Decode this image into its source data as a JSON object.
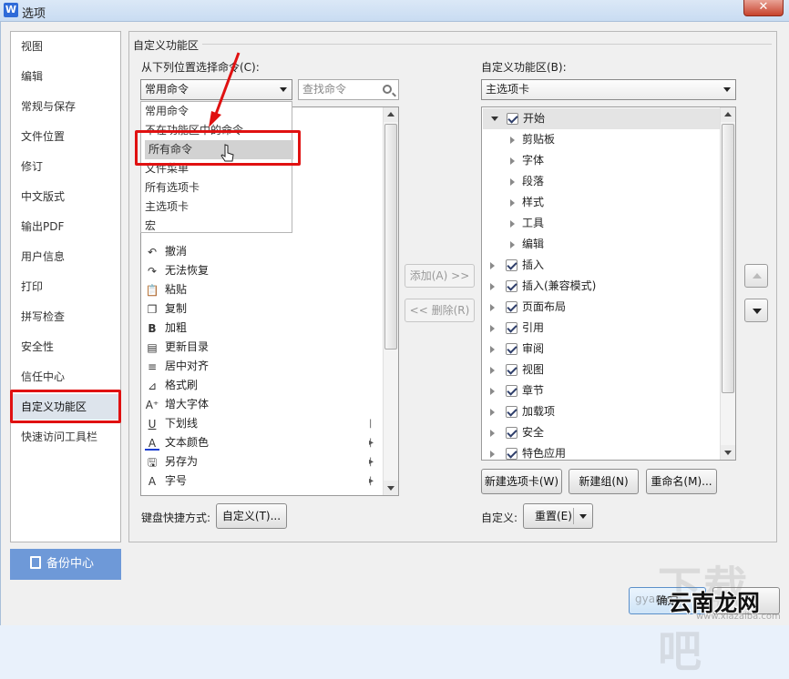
{
  "window": {
    "title": "选项",
    "app_icon_letter": "W",
    "close_glyph": "✕"
  },
  "sidebar": {
    "items": [
      {
        "label": "视图"
      },
      {
        "label": "编辑"
      },
      {
        "label": "常规与保存"
      },
      {
        "label": "文件位置"
      },
      {
        "label": "修订"
      },
      {
        "label": "中文版式"
      },
      {
        "label": "输出PDF"
      },
      {
        "label": "用户信息"
      },
      {
        "label": "打印"
      },
      {
        "label": "拼写检查"
      },
      {
        "label": "安全性"
      },
      {
        "label": "信任中心"
      },
      {
        "label": "自定义功能区"
      },
      {
        "label": "快速访问工具栏"
      }
    ],
    "active": "自定义功能区",
    "backup_label": "备份中心"
  },
  "panel": {
    "group_title": "自定义功能区",
    "choose_from_label": "从下列位置选择命令(C):",
    "choose_from_value": "常用命令",
    "search_placeholder": "查找命令",
    "ribbon_label": "自定义功能区(B):",
    "ribbon_value": "主选项卡",
    "dropdown_options": [
      "常用命令",
      "不在功能区中的命令",
      "所有命令",
      "文件菜单",
      "所有选项卡",
      "主选项卡",
      "宏"
    ],
    "dropdown_selected": "所有命令",
    "commands": [
      {
        "icon": "undo-icon",
        "glyph": "↶",
        "label": "撤消",
        "submenu": false
      },
      {
        "icon": "redo-icon",
        "glyph": "↷",
        "label": "无法恢复",
        "submenu": false
      },
      {
        "icon": "paste-icon",
        "glyph": "📋",
        "label": "粘贴",
        "submenu": false
      },
      {
        "icon": "copy-icon",
        "glyph": "❐",
        "label": "复制",
        "submenu": false
      },
      {
        "icon": "bold-icon",
        "glyph": "B",
        "label": "加粗",
        "submenu": false
      },
      {
        "icon": "update-toc-icon",
        "glyph": "▤",
        "label": "更新目录",
        "submenu": false
      },
      {
        "icon": "align-center-icon",
        "glyph": "≡",
        "label": "居中对齐",
        "submenu": false
      },
      {
        "icon": "format-painter-icon",
        "glyph": "⊿",
        "label": "格式刷",
        "submenu": false
      },
      {
        "icon": "grow-font-icon",
        "glyph": "A⁺",
        "label": "增大字体",
        "submenu": false
      },
      {
        "icon": "underline-icon",
        "glyph": "U",
        "label": "下划线",
        "submenu": true
      },
      {
        "icon": "font-color-icon",
        "glyph": "A",
        "label": "文本颜色",
        "submenu": true
      },
      {
        "icon": "save-as-icon",
        "glyph": "🖫",
        "label": "另存为",
        "submenu": true
      },
      {
        "icon": "font-size-icon",
        "glyph": "A",
        "label": "字号",
        "submenu": true
      }
    ],
    "add_button": "添加(A) >>",
    "remove_button": "<< 删除(R)",
    "tree": [
      {
        "label": "开始",
        "level": 0,
        "expanded": true,
        "checked": true
      },
      {
        "label": "剪贴板",
        "level": 1
      },
      {
        "label": "字体",
        "level": 1
      },
      {
        "label": "段落",
        "level": 1
      },
      {
        "label": "样式",
        "level": 1
      },
      {
        "label": "工具",
        "level": 1
      },
      {
        "label": "编辑",
        "level": 1
      },
      {
        "label": "插入",
        "level": 0,
        "expanded": false,
        "checked": true
      },
      {
        "label": "插入(兼容模式)",
        "level": 0,
        "expanded": false,
        "checked": true
      },
      {
        "label": "页面布局",
        "level": 0,
        "expanded": false,
        "checked": true
      },
      {
        "label": "引用",
        "level": 0,
        "expanded": false,
        "checked": true
      },
      {
        "label": "审阅",
        "level": 0,
        "expanded": false,
        "checked": true
      },
      {
        "label": "视图",
        "level": 0,
        "expanded": false,
        "checked": true
      },
      {
        "label": "章节",
        "level": 0,
        "expanded": false,
        "checked": true
      },
      {
        "label": "加载项",
        "level": 0,
        "expanded": false,
        "checked": true
      },
      {
        "label": "安全",
        "level": 0,
        "expanded": false,
        "checked": true
      },
      {
        "label": "特色应用",
        "level": 0,
        "expanded": false,
        "checked": true
      }
    ],
    "new_tab_button": "新建选项卡(W)",
    "new_group_button": "新建组(N)",
    "rename_button": "重命名(M)...",
    "keyboard_label": "键盘快捷方式:",
    "keyboard_button": "自定义(T)...",
    "custom_label": "自定义:",
    "reset_button": "重置(E)"
  },
  "footer": {
    "ok_button": "确定"
  },
  "watermark": {
    "big": "下载吧",
    "cn": "云南龙网",
    "site": "www.xiazaiba.com",
    "gg": "gyamd"
  },
  "colors": {
    "highlight_red": "#e01111",
    "backup_blue": "#6e99d8",
    "selection_gray": "#d2d2d2"
  }
}
